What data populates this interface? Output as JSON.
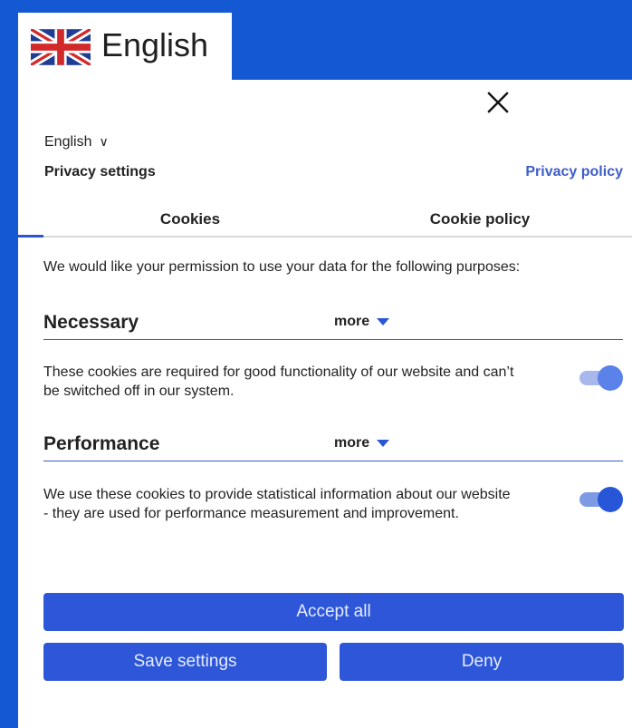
{
  "language_tab": {
    "label": "English",
    "flag_icon": "uk-flag-icon"
  },
  "dialog": {
    "close_icon": "close-icon",
    "language_select": {
      "value": "English",
      "icon": "chevron-down-icon"
    },
    "title": "Privacy settings",
    "privacy_policy_link": "Privacy policy",
    "tabs": [
      {
        "label": "Cookies",
        "active": true
      },
      {
        "label": "Cookie policy",
        "active": false
      }
    ],
    "intro": "We would like your permission to use your data for the following purposes:",
    "sections": [
      {
        "title": "Necessary",
        "more_label": "more",
        "description": "These cookies are required for good functionality of our website and can’t be switched off in our system.",
        "toggle_on": true,
        "toggle_disabled": true
      },
      {
        "title": "Performance",
        "more_label": "more",
        "description": "We use these cookies to provide statistical information about our website - they are used for performance measurement and improvement.",
        "toggle_on": true,
        "toggle_disabled": false
      }
    ],
    "buttons": {
      "accept_all": "Accept all",
      "save_settings": "Save settings",
      "deny": "Deny"
    }
  },
  "colors": {
    "background": "#1458d4",
    "accent": "#2d56d8",
    "link": "#3e5dc8"
  }
}
